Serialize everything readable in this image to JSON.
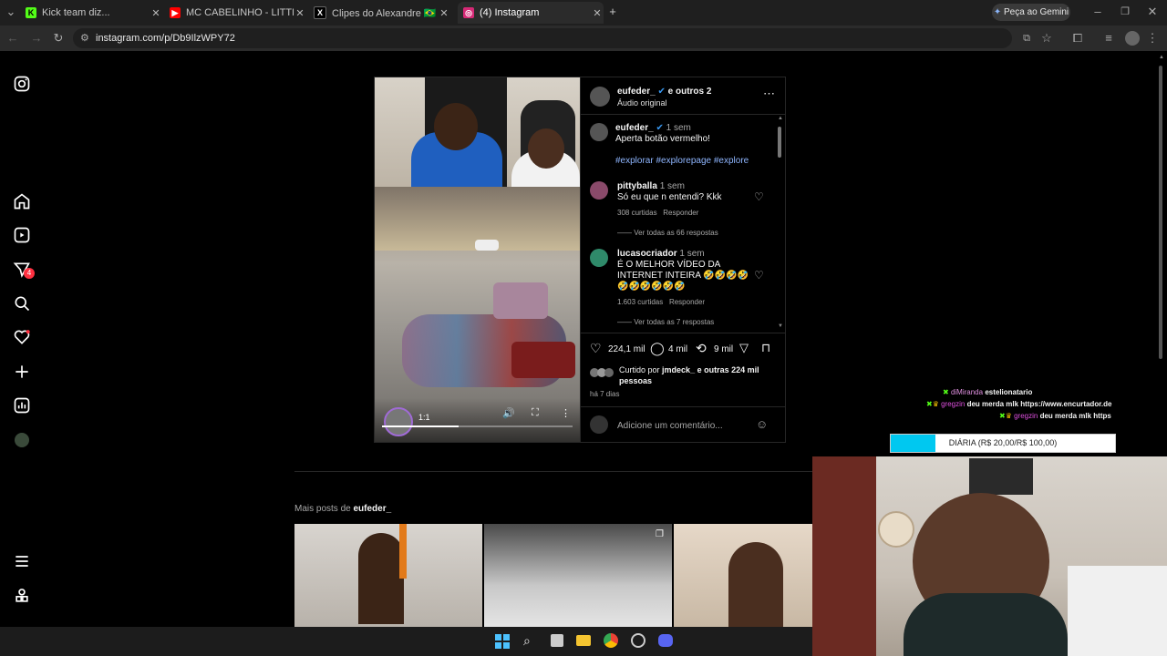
{
  "browser": {
    "tabs": [
      {
        "title": "Kick team diz...",
        "fav": "K",
        "color": "#53fc18"
      },
      {
        "title": "MC CABELINHO - LITTLE HAIR (",
        "fav": "▶",
        "color": "#ff0000"
      },
      {
        "title": "Clipes do Alexandre 🇧🇷 no X: \"Ja",
        "fav": "X",
        "color": "#000000"
      },
      {
        "title": "(4) Instagram",
        "fav": "◎",
        "color": "#d62976"
      }
    ],
    "gemini_label": "Peça ao Gemini",
    "url": "instagram.com/p/Db9IlzWPY72"
  },
  "nav": {
    "icons": [
      "instagram-logo-icon",
      "home-icon",
      "reels-icon",
      "messages-icon",
      "search-icon",
      "notifications-icon",
      "create-icon",
      "dashboard-icon",
      "profile-icon",
      "more-menu-icon",
      "meta-icon"
    ],
    "messages_badge": "4"
  },
  "post": {
    "header": {
      "username": "eufeder_",
      "others": "e outros 2",
      "audio": "Áudio original"
    },
    "caption": {
      "username": "eufeder_",
      "time": "1 sem",
      "text": "Aperta botão vermelho!",
      "tags": "#explorar #explorepage #explore"
    },
    "comments": [
      {
        "username": "pittyballa",
        "time": "1 sem",
        "text": "Só eu que n entendi? Kkk",
        "likes": "308 curtidas",
        "reply": "Responder",
        "view_replies": "Ver todas as 66 respostas"
      },
      {
        "username": "lucasocriador",
        "time": "1 sem",
        "text": "É O MELHOR VÍDEO DA INTERNET INTEIRA 🤣🤣🤣🤣🤣🤣🤣🤣🤣🤣",
        "likes": "1.603 curtidas",
        "reply": "Responder",
        "view_replies": "Ver todas as 7 respostas"
      }
    ],
    "actions": {
      "likes": "224,1 mil",
      "comments": "4 mil",
      "reposts": "9 mil"
    },
    "liked_by": {
      "prefix": "Curtido por",
      "user": "jmdeck_",
      "rest": "e outras 224 mil pessoas"
    },
    "date": "há 7 dias",
    "comment_placeholder": "Adicione um comentário...",
    "video_time": "1:1"
  },
  "more_posts": {
    "prefix": "Mais posts de",
    "user": "eufeder_"
  },
  "stream_overlay": {
    "chat": [
      {
        "user": "diMiranda",
        "msg": "estelionatario"
      },
      {
        "user": "gregzin",
        "msg": "deu merda mlk https://www.encurtador.de"
      },
      {
        "user": "gregzin",
        "msg": "deu merda mlk https"
      }
    ],
    "goal": "DIÁRIA (R$ 20,00/R$ 100,00)",
    "goal_progress": 0.2
  }
}
